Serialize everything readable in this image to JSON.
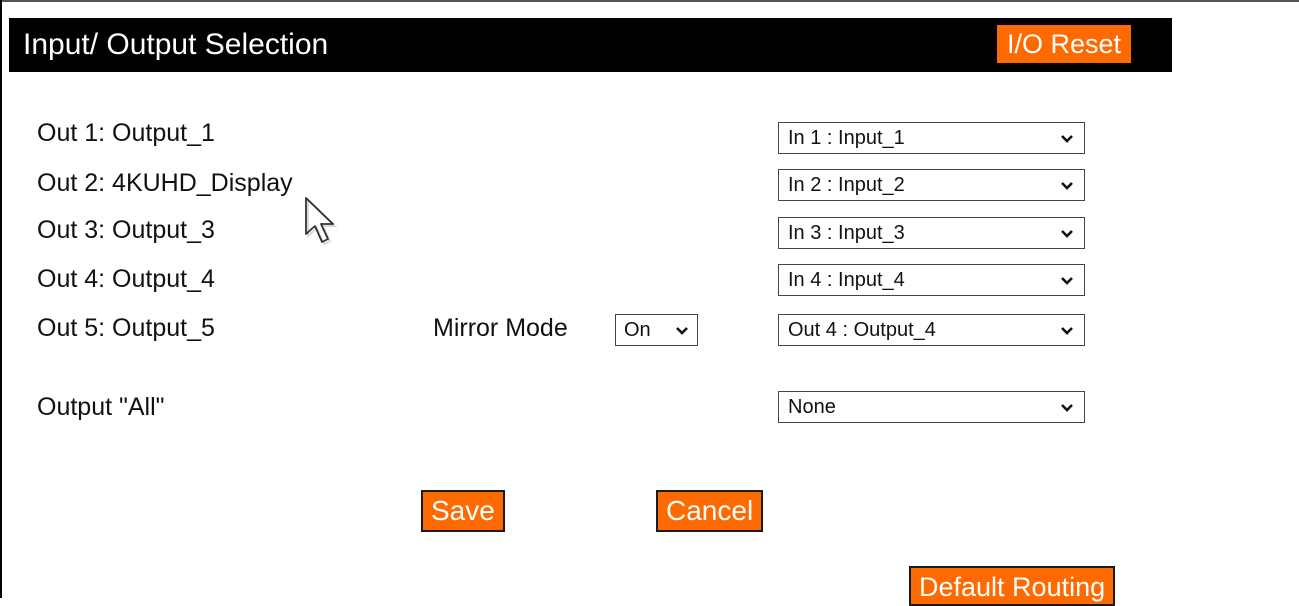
{
  "header": {
    "title": "Input/ Output Selection",
    "reset_label": "I/O Reset"
  },
  "outputs": [
    {
      "label": "Out 1: Output_1",
      "selected": "In 1 : Input_1"
    },
    {
      "label": "Out 2: 4KUHD_Display",
      "selected": "In 2 : Input_2"
    },
    {
      "label": "Out 3: Output_3",
      "selected": "In 3 : Input_3"
    },
    {
      "label": "Out 4: Output_4",
      "selected": "In 4 : Input_4"
    },
    {
      "label": "Out 5: Output_5",
      "selected": "Out 4 : Output_4"
    }
  ],
  "mirror_mode": {
    "label": "Mirror Mode",
    "selected": "On"
  },
  "output_all": {
    "label": "Output \"All\"",
    "selected": "None"
  },
  "actions": {
    "save_label": "Save",
    "cancel_label": "Cancel",
    "default_routing_label": "Default Routing"
  },
  "colors": {
    "accent": "#ff6a00",
    "header_bg": "#000000",
    "text": "#111111"
  }
}
